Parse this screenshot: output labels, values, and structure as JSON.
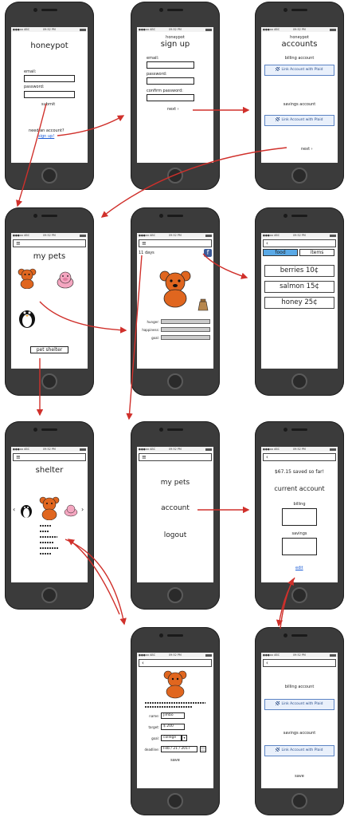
{
  "status": {
    "carrier": "●●●oo ABC",
    "time": "09:52 PM"
  },
  "login": {
    "title": "honeypot",
    "email_label": "email:",
    "password_label": "password:",
    "submit_label": "submit",
    "need_account": "need an account?",
    "signup_link": "sign up!"
  },
  "signup": {
    "app_name": "honeypot",
    "title": "sign up",
    "email_label": "email:",
    "password_label": "password:",
    "confirm_label": "confirm password:",
    "next_label": "next ›"
  },
  "accounts": {
    "app_name": "honeypot",
    "title": "accounts",
    "billing_label": "billing account",
    "savings_label": "savings account",
    "plaid_label": "Link Account with Plaid",
    "next_label": "next ›"
  },
  "mypets": {
    "menu_icon": "≡",
    "title": "my pets",
    "shelter_button": "pet shelter"
  },
  "petdetail": {
    "days": "11 days",
    "hunger_label": "hunger:",
    "happiness_label": "happiness:",
    "goal_label": "goal:",
    "fb_icon": "f"
  },
  "store": {
    "back_icon": "‹",
    "tab_food": "food",
    "tab_items": "items",
    "items": [
      "berries 10¢",
      "salmon 15¢",
      "honey 25¢"
    ]
  },
  "shelter": {
    "title": "shelter",
    "prev": "‹",
    "next": "›"
  },
  "menu": {
    "items": [
      "my pets",
      "account",
      "logout"
    ]
  },
  "account": {
    "saved": "$67.15 saved so far!",
    "title": "current account",
    "billing_label": "billing",
    "savings_label": "savings",
    "edit_link": "edit"
  },
  "adopt": {
    "name_label": "name:",
    "name_value": "Jimbo",
    "target_label": "target:",
    "target_value": "$ 200",
    "goal_label": "goal:",
    "goal_value": "college",
    "deadline_label": "deadline:",
    "deadline_value": "Feb / 21 / 2017",
    "save_label": "save"
  },
  "editaccount": {
    "billing_label": "billing account",
    "savings_label": "savings account",
    "plaid_label": "Link Account with Plaid",
    "save_label": "save"
  },
  "colors": {
    "arrow": "#d0302b",
    "bear": "#e0661f",
    "link": "#1a5bd6",
    "tab_active": "#5aa9e6"
  }
}
